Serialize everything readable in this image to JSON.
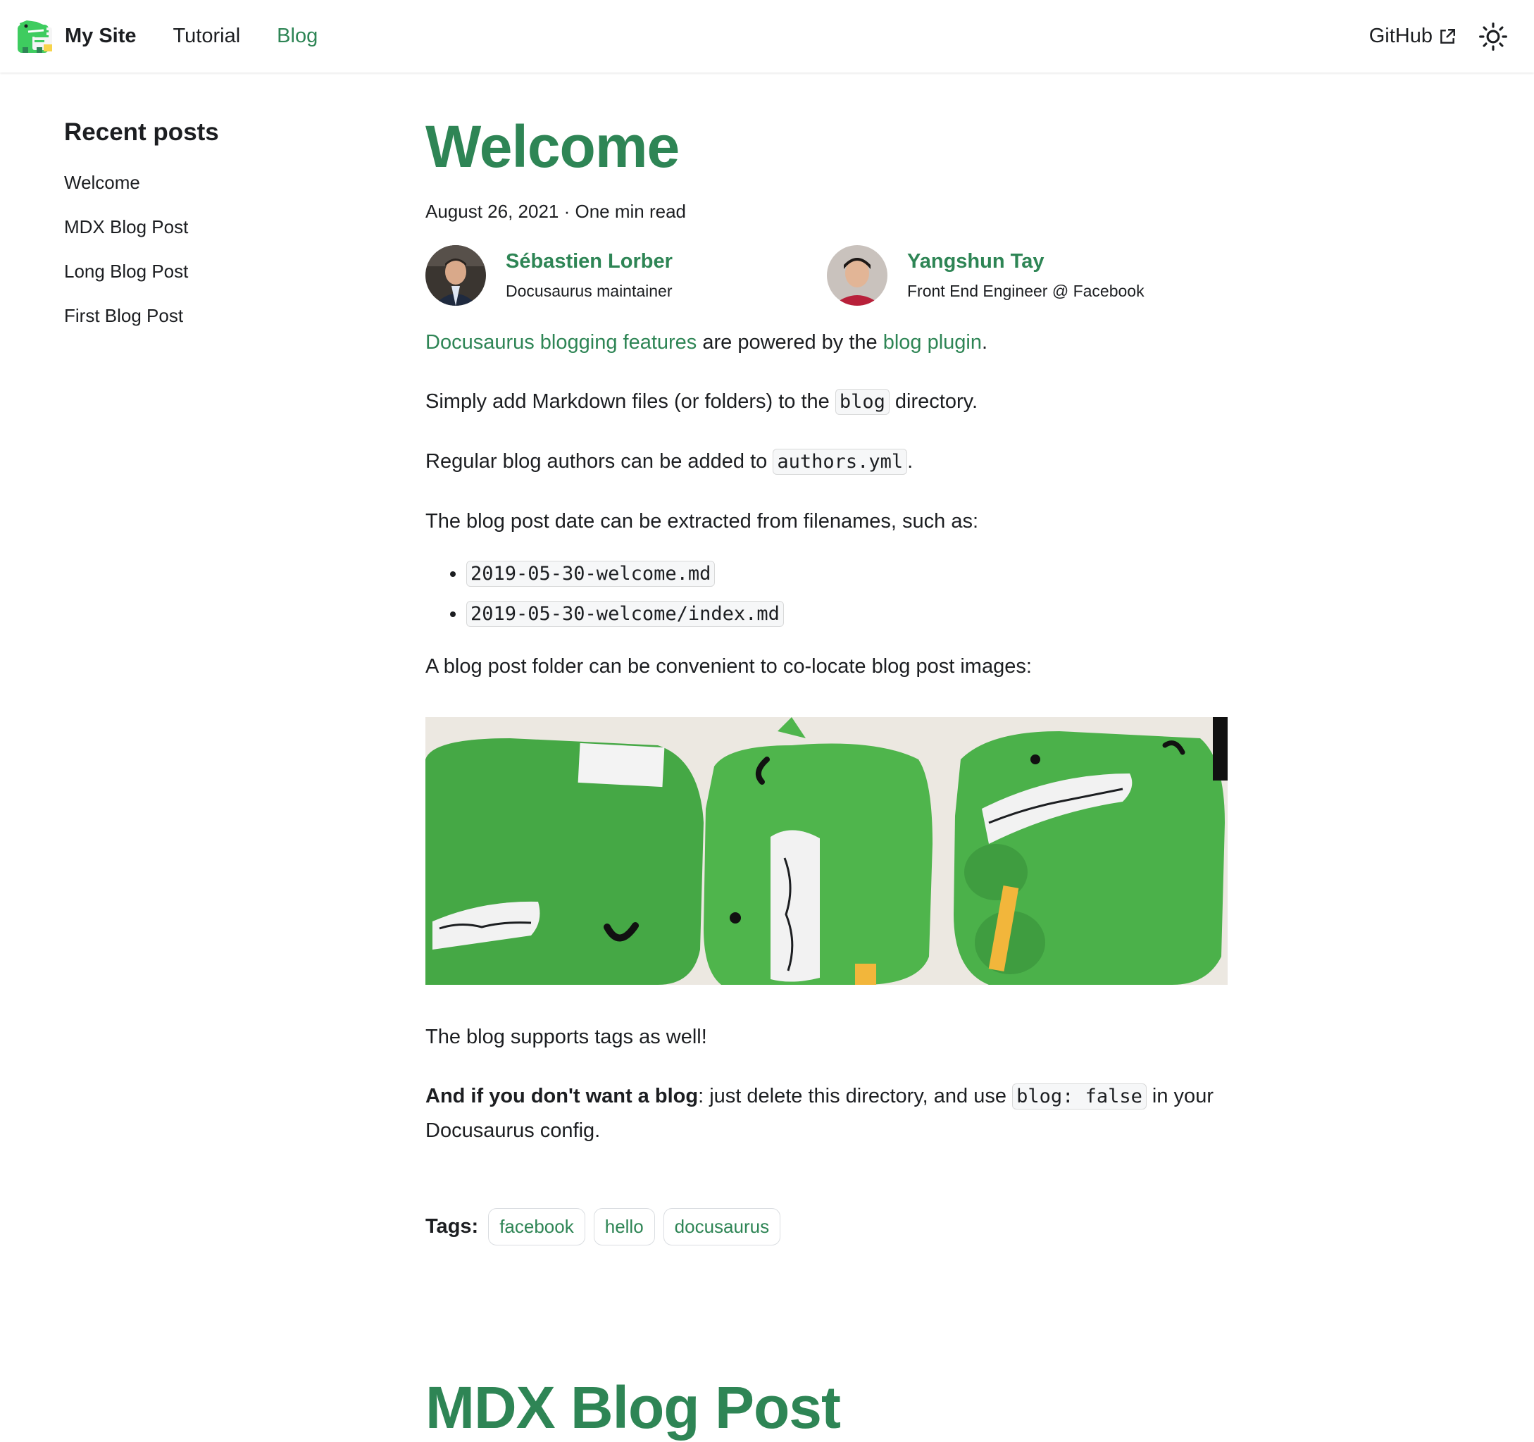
{
  "navbar": {
    "brand": "My Site",
    "links": [
      "Tutorial",
      "Blog"
    ],
    "active_link": "Blog",
    "github_label": "GitHub",
    "icons": {
      "logo": "dinosaur-logo-icon",
      "external": "external-link-icon",
      "theme": "sun-icon"
    }
  },
  "sidebar": {
    "title": "Recent posts",
    "items": [
      "Welcome",
      "MDX Blog Post",
      "Long Blog Post",
      "First Blog Post"
    ]
  },
  "post": {
    "title": "Welcome",
    "meta": "August 26, 2021 · One min read",
    "authors": [
      {
        "name": "Sébastien Lorber",
        "title": "Docusaurus maintainer"
      },
      {
        "name": "Yangshun Tay",
        "title": "Front End Engineer @ Facebook"
      }
    ],
    "p1": {
      "link1": "Docusaurus blogging features",
      "text1": " are powered by the ",
      "link2": "blog plugin",
      "end": "."
    },
    "p2": {
      "before": "Simply add Markdown files (or folders) to the ",
      "code": "blog",
      "after": " directory."
    },
    "p3": {
      "before": "Regular blog authors can be added to ",
      "code": "authors.yml",
      "after": "."
    },
    "p4": "The blog post date can be extracted from filenames, such as:",
    "files": [
      "2019-05-30-welcome.md",
      "2019-05-30-welcome/index.md"
    ],
    "p5": "A blog post folder can be convenient to co-locate blog post images:",
    "image_alt": "three green dinosaur plush toys",
    "p6": "The blog supports tags as well!",
    "p7": {
      "bold": "And if you don't want a blog",
      "before": ": just delete this directory, and use ",
      "code": "blog: false",
      "after": " in your Docusaurus config."
    },
    "tags_label": "Tags:",
    "tags": [
      "facebook",
      "hello",
      "docusaurus"
    ]
  },
  "next_post_title": "MDX Blog Post",
  "colors": {
    "accent": "#2e8555",
    "text": "#1c1e21",
    "code_bg": "#f6f7f8"
  }
}
